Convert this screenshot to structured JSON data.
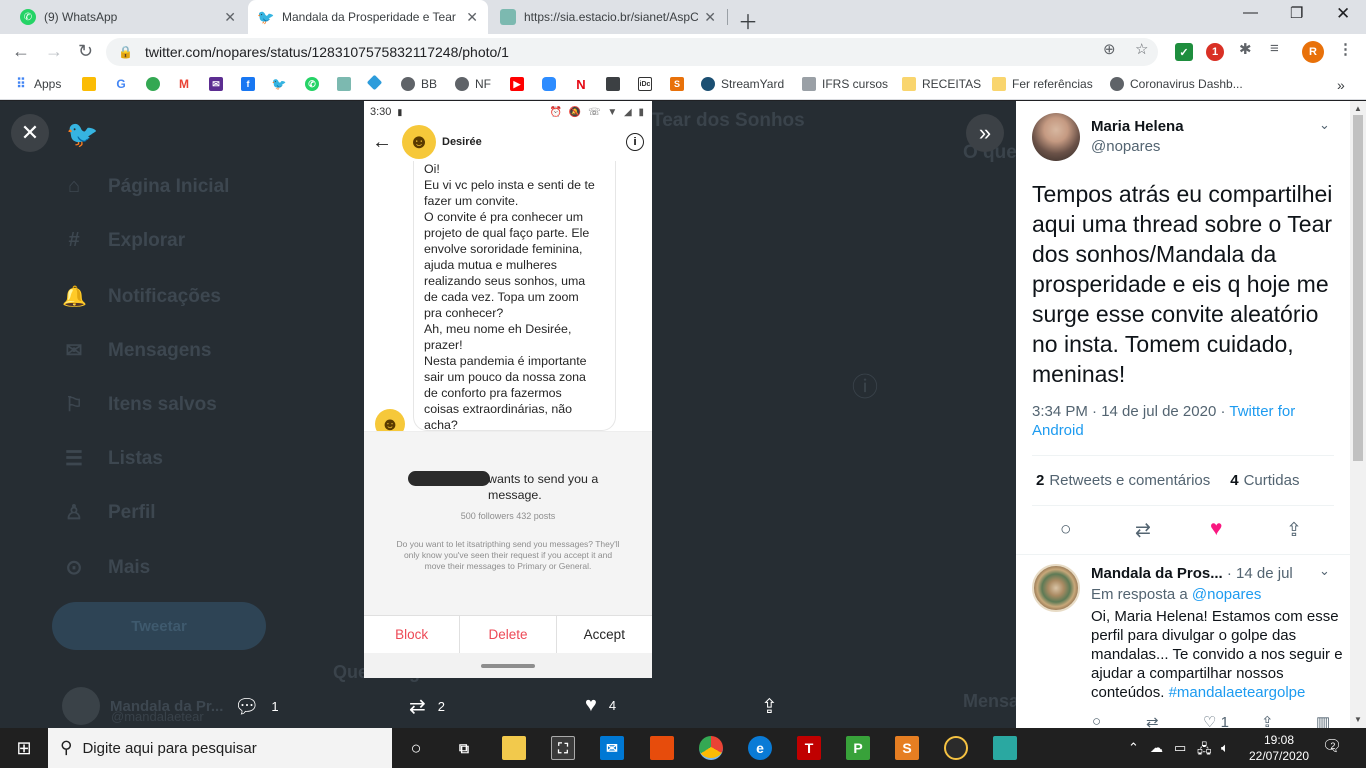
{
  "browser": {
    "tabs": [
      {
        "title": "(9) WhatsApp",
        "icon": "whatsapp-icon",
        "color": "#25d366"
      },
      {
        "title": "Mandala da Prosperidade e Tear",
        "icon": "twitter-icon",
        "color": "#1d9bf0"
      },
      {
        "title": "https://sia.estacio.br/sianet/AspC",
        "icon": "globe-icon",
        "color": "#7cb9b0"
      }
    ],
    "url": "twitter.com/nopares/status/1283107575832117248/photo/1",
    "profile_initial": "R",
    "extension_badge": "1",
    "bookmarks": [
      "Apps",
      "BB",
      "NF",
      "StreamYard",
      "IFRS cursos",
      "RECEITAS",
      "Fer referências",
      "Coronavirus Dashb..."
    ]
  },
  "background": {
    "nav": [
      "Página Inicial",
      "Explorar",
      "Notificações",
      "Mensagens",
      "Itens salvos",
      "Listas",
      "Perfil",
      "Mais"
    ],
    "tweet_button": "Tweetar",
    "header_title": "Tear dos Sonhos",
    "trends_title": "O que",
    "account_name": "Mandala da Pr...",
    "account_handle": "@mandalaetear",
    "who_to_follow": "Quem seguir",
    "messages": "Mensa"
  },
  "phone": {
    "time": "3:30",
    "contact_name": "Desirée",
    "message_lines": [
      "Oi!",
      "Eu vi vc pelo insta e senti de te",
      "fazer um convite.",
      "O convite é pra conhecer um",
      "projeto de qual faço parte. Ele",
      "envolve sororidade feminina,",
      "ajuda mutua e mulheres",
      "realizando seus sonhos, uma",
      "de cada vez. Topa um zoom",
      "pra conhecer?",
      "Ah, meu nome eh Desirée,",
      "prazer!",
      "Nesta pandemia é importante",
      "sair um pouco da nossa zona",
      "de conforto pra fazermos",
      "coisas extraordinárias, não",
      "acha?"
    ],
    "request_text": "wants to send you a message.",
    "followers": "500 followers 432 posts",
    "question": "Do you want to let itsatripthing send you messages? They'll only know you've seen their request if you accept it and move their messages to Primary or General.",
    "actions": {
      "block": "Block",
      "delete": "Delete",
      "accept": "Accept"
    }
  },
  "viewer_bar": {
    "replies": "1",
    "retweets": "2",
    "likes": "4"
  },
  "tweet": {
    "name": "Maria Helena",
    "handle": "@nopares",
    "text": "Tempos atrás eu compartilhei aqui uma thread sobre o Tear dos sonhos/Mandala da prosperidade e eis q hoje me surge esse convite aleatório no insta. Tomem cuidado, meninas!",
    "time": "3:34 PM · 14 de jul de 2020 · ",
    "source": "Twitter for Android",
    "retweets_count": "2",
    "retweets_label": "Retweets e comentários",
    "likes_count": "4",
    "likes_label": "Curtidas"
  },
  "reply": {
    "name": "Mandala da Pros...",
    "date": " · 14 de jul",
    "replying_prefix": "Em resposta a ",
    "replying_to": "@nopares",
    "text": "Oi, Maria Helena! Estamos com esse perfil para divulgar o golpe das mandalas... Te convido a nos seguir e ajudar a compartilhar nossos conteúdos. ",
    "hashtag": "#mandalaeteargolpe",
    "likes": "1"
  },
  "taskbar": {
    "search_placeholder": "Digite aqui para pesquisar",
    "time": "19:08",
    "date": "22/07/2020",
    "notifications": "2"
  }
}
